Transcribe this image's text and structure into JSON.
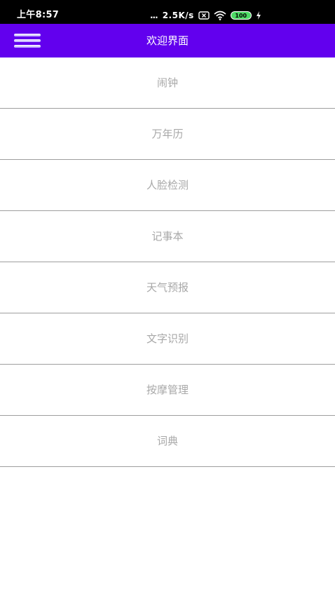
{
  "status_bar": {
    "time": "上午8:57",
    "dots": "...",
    "network_speed": "2.5K/s",
    "icons": [
      "sim-x-icon",
      "wifi-icon",
      "battery-icon",
      "charging-icon"
    ],
    "battery_level": "100",
    "colors": {
      "background": "#000000",
      "battery": "#4cd964"
    }
  },
  "app_bar": {
    "title": "欢迎界面",
    "menu_icon": "hamburger-menu-icon",
    "color": "#6200ee"
  },
  "menu": {
    "items": [
      {
        "label": "闹钟"
      },
      {
        "label": "万年历"
      },
      {
        "label": "人脸检测"
      },
      {
        "label": "记事本"
      },
      {
        "label": "天气预报"
      },
      {
        "label": "文字识别"
      },
      {
        "label": "按摩管理"
      },
      {
        "label": "词典"
      }
    ],
    "text_color": "#a8a8a8",
    "divider_color": "#9e9e9e"
  }
}
